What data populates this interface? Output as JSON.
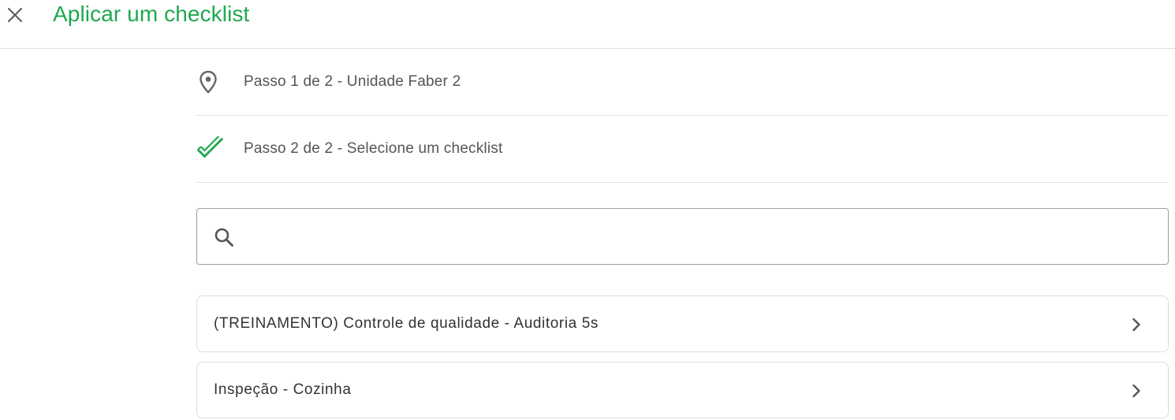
{
  "header": {
    "title": "Aplicar um checklist",
    "close_icon": "close-icon",
    "accent_color": "#1fa84f"
  },
  "steps": [
    {
      "label": "Passo 1 de 2 - Unidade Faber 2",
      "icon": "location-pin-icon"
    },
    {
      "label": "Passo 2 de 2 - Selecione um checklist",
      "icon": "double-check-icon"
    }
  ],
  "search": {
    "value": "",
    "placeholder": "",
    "icon": "search-icon"
  },
  "checklists": [
    {
      "label": "(TREINAMENTO) Controle de qualidade - Auditoria 5s",
      "icon": "chevron-right-icon"
    },
    {
      "label": "Inspeção - Cozinha",
      "icon": "chevron-right-icon"
    }
  ]
}
